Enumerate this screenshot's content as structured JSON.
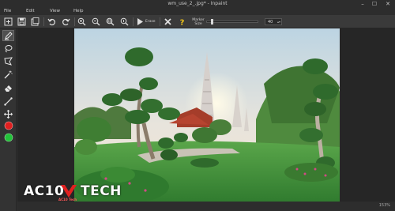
{
  "window": {
    "title": "wm_use_2_.jpg* - Inpaint",
    "controls": {
      "minimize": "–",
      "maximize": "☐",
      "close": "✕"
    }
  },
  "menu": {
    "items": [
      "File",
      "Edit",
      "View",
      "Help"
    ]
  },
  "toolbar": {
    "erase_label": "Erase",
    "marker_label_line1": "Marker",
    "marker_label_line2": "Size",
    "marker_size_value": "40",
    "marker_size_level": 0.08,
    "icons": [
      "open-icon",
      "save-icon",
      "save-as-icon",
      "undo-icon",
      "redo-icon",
      "zoom-in-icon",
      "zoom-out-icon",
      "zoom-fit-icon",
      "zoom-actual-icon",
      "erase-icon",
      "cancel-icon",
      "help-icon"
    ]
  },
  "tools": {
    "icons": [
      "marker-icon",
      "lasso-icon",
      "polygon-lasso-icon",
      "magic-wand-icon",
      "eraser-icon",
      "line-icon",
      "move-icon",
      "red-marker-icon",
      "green-marker-icon"
    ],
    "colors": {
      "red": "#e02020",
      "green": "#22c33a"
    }
  },
  "status": {
    "zoom": "153%"
  },
  "watermark": {
    "text_left": "AC10",
    "text_right": "TECH",
    "subtext": "AC10 Tech"
  },
  "colors": {
    "accent": "#3aa0ff",
    "help": "#f0c419",
    "sky": "#cfe2ee",
    "grass": "#3f8f3a"
  }
}
